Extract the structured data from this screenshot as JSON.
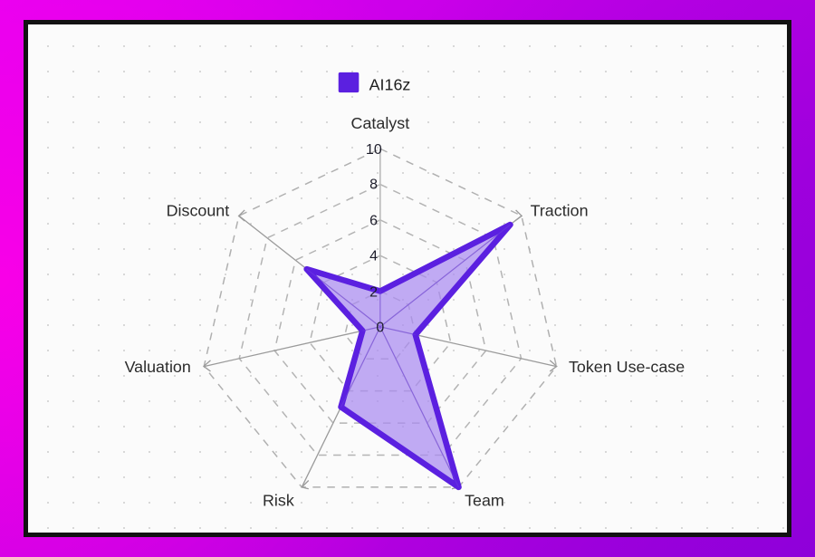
{
  "theme": {
    "frame_gradient_start": "#e100f5",
    "frame_gradient_end": "#8a00d8",
    "card_border": "#121212",
    "card_background": "#fbfbfb",
    "grid_dot": "#d8d8d8",
    "accent": "#5b20e0",
    "series_fill": "#a98bf0",
    "series_stroke": "#5b20e0"
  },
  "legend": {
    "position": "top-center",
    "entries": [
      {
        "label": "AI16z",
        "color": "#5b20e0",
        "marker": "square"
      }
    ]
  },
  "axis_labels": {
    "catalyst": "Catalyst",
    "traction": "Traction",
    "token_use_case": "Token Use-case",
    "team": "Team",
    "risk": "Risk",
    "valuation": "Valuation",
    "discount": "Discount"
  },
  "ticks": {
    "t0": "0",
    "t2": "2",
    "t4": "4",
    "t6": "6",
    "t8": "8",
    "t10": "10"
  },
  "chart_data": {
    "type": "radar",
    "title": "",
    "subtitle": "",
    "xlabel": "",
    "ylabel": "",
    "categories": [
      "Catalyst",
      "Traction",
      "Token Use-case",
      "Team",
      "Risk",
      "Valuation",
      "Discount"
    ],
    "tick_labels": [
      "0",
      "2",
      "4",
      "6",
      "8",
      "10"
    ],
    "rlim": [
      0,
      10
    ],
    "rtick_step": 2,
    "grid": true,
    "legend_position": "top-center",
    "series": [
      {
        "name": "AI16z",
        "color": "#5b20e0",
        "fill": "#a98bf0",
        "values": [
          2,
          9.2,
          2,
          10,
          5,
          1,
          5.2
        ]
      }
    ]
  }
}
